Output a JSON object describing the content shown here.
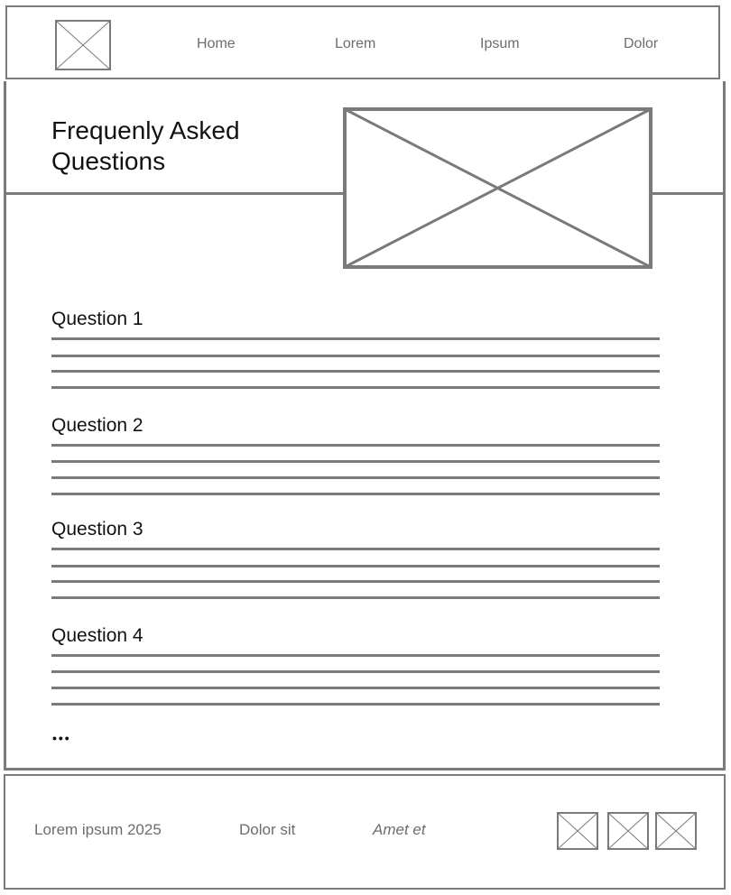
{
  "header": {
    "logo_icon": "image-placeholder-icon",
    "nav": [
      {
        "label": "Home"
      },
      {
        "label": "Lorem"
      },
      {
        "label": "Ipsum"
      },
      {
        "label": "Dolor"
      }
    ]
  },
  "hero": {
    "title": "Frequenly Asked Questions",
    "image_icon": "image-placeholder-icon"
  },
  "faq": {
    "items": [
      {
        "question": "Question 1"
      },
      {
        "question": "Question 2"
      },
      {
        "question": "Question 3"
      },
      {
        "question": "Question 4"
      }
    ],
    "more_indicator": "•••"
  },
  "footer": {
    "copyright": "Lorem ipsum 2025",
    "link_1": "Dolor sit",
    "link_2": "Amet et",
    "social_icons": [
      "image-placeholder-icon",
      "image-placeholder-icon",
      "image-placeholder-icon"
    ]
  },
  "colors": {
    "wireframe_gray": "#7a7a7a",
    "text_dark": "#111111",
    "text_muted": "#6d6d6d"
  }
}
